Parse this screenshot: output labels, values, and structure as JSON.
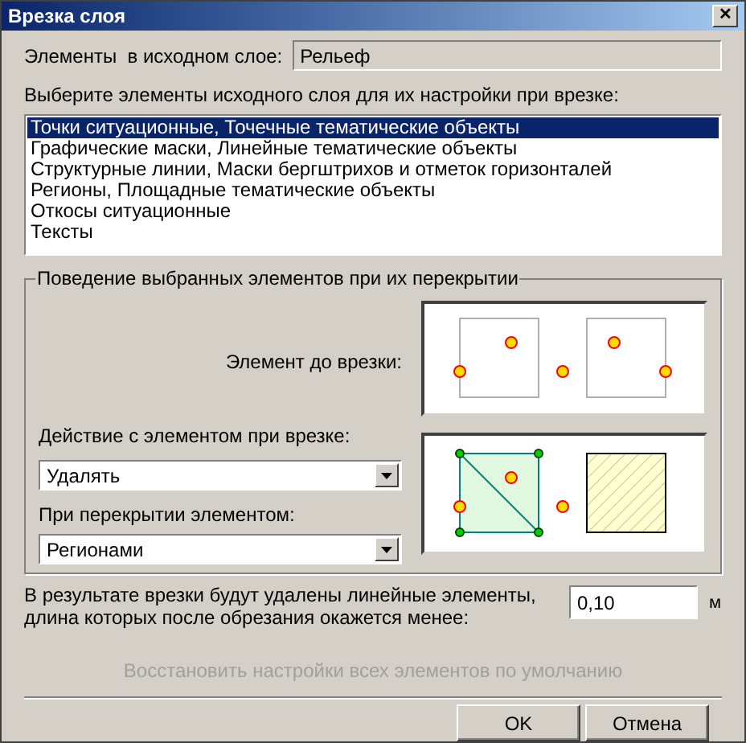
{
  "window": {
    "title": "Врезка слоя",
    "close": "✕"
  },
  "source_layer": {
    "label": "Элементы  в исходном слое:",
    "value": "Рельеф"
  },
  "elements_list": {
    "label": "Выберите элементы исходного слоя для их настройки при врезке:",
    "items": [
      {
        "label": "Точки ситуационные, Точечные тематические объекты",
        "selected": true
      },
      {
        "label": "Графические маски, Линейные тематические объекты",
        "selected": false
      },
      {
        "label": "Структурные линии, Маски бергштрихов и отметок горизонталей",
        "selected": false
      },
      {
        "label": "Регионы, Площадные тематические объекты",
        "selected": false
      },
      {
        "label": "Откосы ситуационные",
        "selected": false
      },
      {
        "label": "Тексты",
        "selected": false
      }
    ]
  },
  "behavior": {
    "title": "Поведение выбранных элементов при их перекрытии",
    "before_label": "Элемент до врезки:",
    "action": {
      "label": "Действие с элементом при врезке:",
      "value": "Удалять"
    },
    "overlap": {
      "label": "При перекрытии элементом:",
      "value": "Регионами"
    }
  },
  "min_length": {
    "label": "В результате врезки будут удалены линейные элементы,\nдлина которых после обрезания окажется менее:",
    "value": "0,10",
    "unit": "м"
  },
  "restore": {
    "label": "Восстановить настройки всех элементов по умолчанию",
    "disabled": true
  },
  "buttons": [
    {
      "label": "OK"
    },
    {
      "label": "Отмена"
    }
  ]
}
